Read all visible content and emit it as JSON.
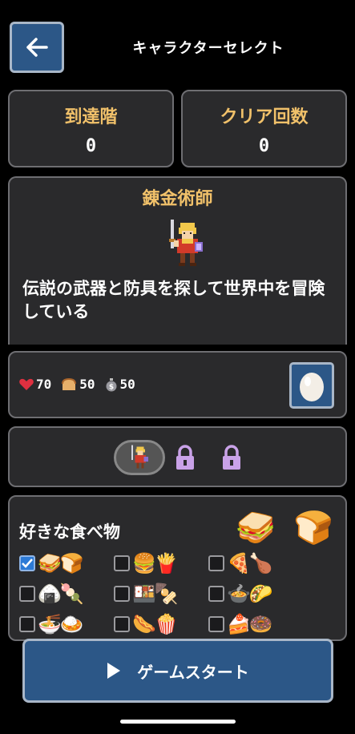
{
  "header": {
    "title": "キャラクターセレクト",
    "back_icon": "arrow-left-icon"
  },
  "stats": {
    "reached_floor_label": "到達階",
    "reached_floor_value": "0",
    "clear_count_label": "クリア回数",
    "clear_count_value": "0"
  },
  "character": {
    "name": "錬金術師",
    "description": "伝説の武器と防具を探して世界中を冒険している",
    "hp": "70",
    "food": "50",
    "money": "50",
    "item_icon": "egg-icon"
  },
  "character_select": {
    "locked_slots": 2
  },
  "food_pref": {
    "title": "好きな食べ物",
    "preview_emojis": [
      "🥪",
      "🍞"
    ],
    "options": [
      {
        "id": "sandwich-bread",
        "emojis": "🥪🍞",
        "checked": true
      },
      {
        "id": "burger-fries",
        "emojis": "🍔🍟",
        "checked": false
      },
      {
        "id": "pizza-chicken",
        "emojis": "🍕🍗",
        "checked": false
      },
      {
        "id": "onigiri-dango",
        "emojis": "🍙🍡",
        "checked": false
      },
      {
        "id": "bento-oden",
        "emojis": "🍱🍢",
        "checked": false
      },
      {
        "id": "nabe-taco",
        "emojis": "🍲🌮",
        "checked": false
      },
      {
        "id": "ramen-curry",
        "emojis": "🍜🍛",
        "checked": false
      },
      {
        "id": "hotdog-popcorn",
        "emojis": "🌭🍿",
        "checked": false
      },
      {
        "id": "cake-donut",
        "emojis": "🍰🍩",
        "checked": false
      }
    ]
  },
  "start_button": {
    "label": "ゲームスタート"
  },
  "colors": {
    "accent": "#2c5787",
    "gold": "#f1c16a",
    "panel": "#2a2a2c",
    "lock": "#c9a2e8"
  }
}
